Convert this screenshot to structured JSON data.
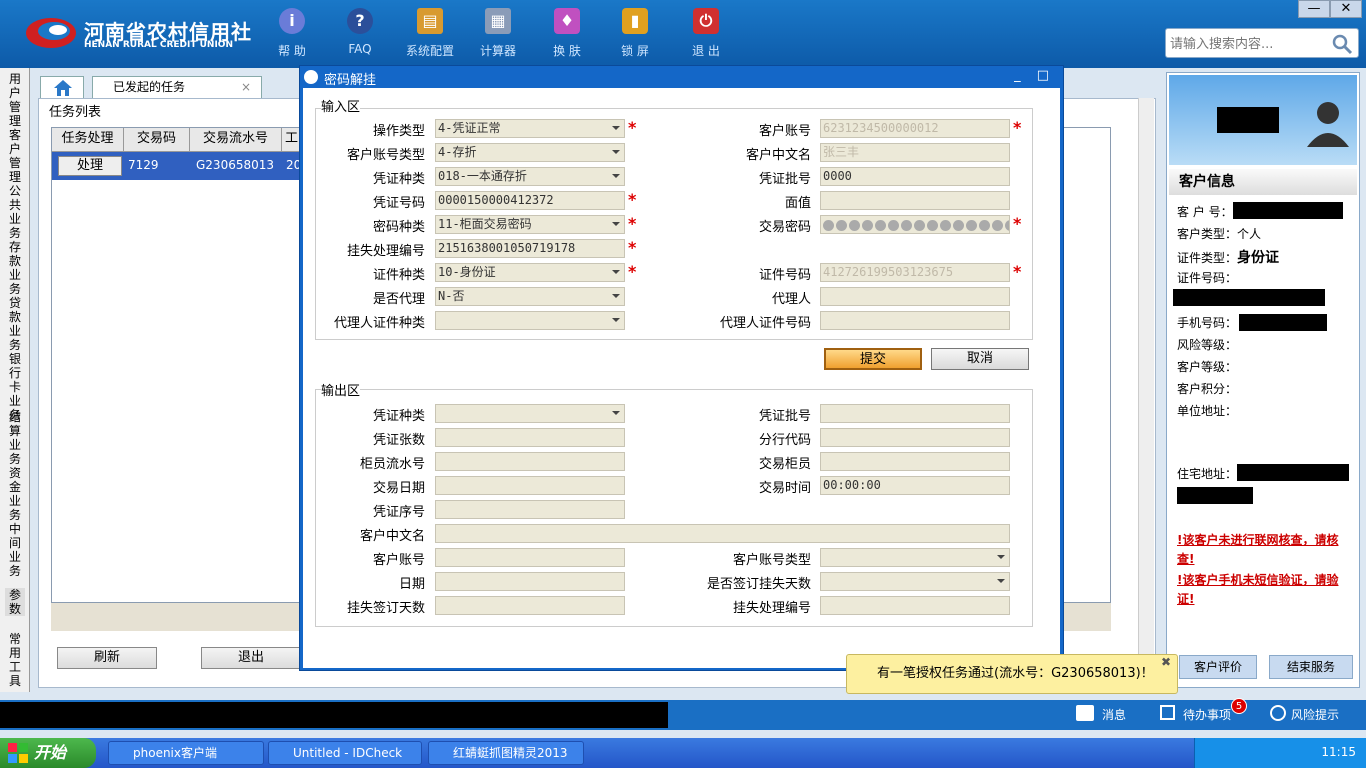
{
  "brand": {
    "name_cn": "河南省农村信用社",
    "name_en": "HENAN RURAL CREDIT UNION"
  },
  "toolbar": [
    {
      "label": "帮 助",
      "icon": "info-icon"
    },
    {
      "label": "FAQ",
      "icon": "question-icon"
    },
    {
      "label": "系统配置",
      "icon": "toolbox-icon"
    },
    {
      "label": "计算器",
      "icon": "calculator-icon"
    },
    {
      "label": "换 肤",
      "icon": "shirt-icon"
    },
    {
      "label": "锁 屏",
      "icon": "lock-icon"
    },
    {
      "label": "退 出",
      "icon": "power-icon"
    }
  ],
  "search": {
    "placeholder": "请输入搜索内容..."
  },
  "window_controls": {
    "minimize": "—",
    "close": "✕"
  },
  "left_nav": [
    "用户管理",
    "客户管理",
    "公共业务",
    "存款业务",
    "贷款业务",
    "银行卡业务",
    "结算业务",
    "资金业务",
    "中间业务",
    "参数",
    "常用工具"
  ],
  "tabs": {
    "task_tab": "已发起的任务",
    "close": "×"
  },
  "task_panel": {
    "title": "任务列表",
    "columns": [
      "任务处理",
      "交易码",
      "交易流水号",
      "工"
    ],
    "row": {
      "action": "处理",
      "code": "7129",
      "serial": "G230658013",
      "extra": "20"
    },
    "refresh": "刷新",
    "exit": "退出"
  },
  "dialog": {
    "title": "密码解挂",
    "controls": "_ □",
    "input_section": "输入区",
    "output_section": "输出区",
    "input_left": [
      {
        "label": "操作类型",
        "value": "4-凭证正常",
        "dropdown": true,
        "required": true
      },
      {
        "label": "客户账号类型",
        "value": "4-存折",
        "dropdown": true,
        "required": false
      },
      {
        "label": "凭证种类",
        "value": "018-一本通存折",
        "dropdown": true,
        "required": false
      },
      {
        "label": "凭证号码",
        "value": "0000150000412372",
        "dropdown": false,
        "required": true
      },
      {
        "label": "密码种类",
        "value": "11-柜面交易密码",
        "dropdown": true,
        "required": true
      },
      {
        "label": "挂失处理编号",
        "value": "2151638001050719178",
        "dropdown": false,
        "required": true
      },
      {
        "label": "证件种类",
        "value": "10-身份证",
        "dropdown": true,
        "required": true
      },
      {
        "label": "是否代理",
        "value": "N-否",
        "dropdown": true,
        "required": false
      },
      {
        "label": "代理人证件种类",
        "value": "",
        "dropdown": true,
        "required": false
      }
    ],
    "input_right": [
      {
        "label": "客户账号",
        "value": "6231234500000012",
        "required": true,
        "blur": true
      },
      {
        "label": "客户中文名",
        "value": "张三丰",
        "required": false,
        "blur": true
      },
      {
        "label": "凭证批号",
        "value": "0000",
        "required": false,
        "blur": false
      },
      {
        "label": "面值",
        "value": "",
        "required": false,
        "blur": false
      },
      {
        "label": "交易密码",
        "value": "",
        "required": true,
        "blur": false,
        "password": true
      },
      {
        "label": "",
        "value": "",
        "hidden": true
      },
      {
        "label": "证件号码",
        "value": "412726199503123675",
        "required": true,
        "blur": true
      },
      {
        "label": "代理人",
        "value": "",
        "required": false,
        "blur": false
      },
      {
        "label": "代理人证件号码",
        "value": "",
        "required": false,
        "blur": false
      }
    ],
    "submit": "提交",
    "cancel": "取消",
    "output_left": [
      {
        "label": "凭证种类",
        "value": "",
        "dropdown": true
      },
      {
        "label": "凭证张数",
        "value": "",
        "dropdown": false
      },
      {
        "label": "柜员流水号",
        "value": "",
        "dropdown": false
      },
      {
        "label": "交易日期",
        "value": "",
        "dropdown": false
      },
      {
        "label": "凭证序号",
        "value": "",
        "dropdown": false
      }
    ],
    "output_right": [
      {
        "label": "凭证批号",
        "value": ""
      },
      {
        "label": "分行代码",
        "value": ""
      },
      {
        "label": "交易柜员",
        "value": ""
      },
      {
        "label": "交易时间",
        "value": "00:00:00"
      }
    ],
    "out_name_label": "客户中文名",
    "output_bottom_left": [
      {
        "label": "客户账号",
        "value": ""
      },
      {
        "label": "日期",
        "value": ""
      },
      {
        "label": "挂失签订天数",
        "value": ""
      }
    ],
    "output_bottom_right": [
      {
        "label": "客户账号类型",
        "value": "",
        "dropdown": true
      },
      {
        "label": "是否签订挂失天数",
        "value": "",
        "dropdown": true
      },
      {
        "label": "挂失处理编号",
        "value": "",
        "dropdown": false
      }
    ]
  },
  "customer": {
    "header": "客户信息",
    "fields": [
      {
        "label": "客 户 号：",
        "value": ""
      },
      {
        "label": "客户类型：",
        "value": "个人"
      },
      {
        "label": "证件类型：",
        "value": "身份证"
      },
      {
        "label": "证件号码：",
        "value": ""
      },
      {
        "label": "手机号码：",
        "value": ""
      },
      {
        "label": "风险等级：",
        "value": ""
      },
      {
        "label": "客户等级：",
        "value": ""
      },
      {
        "label": "客户积分：",
        "value": ""
      },
      {
        "label": "单位地址：",
        "value": ""
      },
      {
        "label": "住宅地址：",
        "value": ""
      }
    ],
    "warning1": "!该客户未进行联网核查，请核查!",
    "warning2": "!该客户手机未短信验证，请验证!",
    "evaluate": "客户评价",
    "end_service": "结束服务"
  },
  "notification": {
    "text": "有一笔授权任务通过(流水号：G230658013)！",
    "close": "✖"
  },
  "status": {
    "message": "消息",
    "todo": "待办事项",
    "todo_count": "5",
    "risk": "风险提示"
  },
  "taskbar": {
    "start": "开始",
    "tasks": [
      "phoenix客户端",
      "Untitled - IDCheck",
      "红蜻蜓抓图精灵2013"
    ],
    "clock": "11:15"
  },
  "colors": {
    "brand_blue": "#1a78c8",
    "dialog_blue": "#1467c8",
    "required_red": "#d00000",
    "field_bg": "#ece9d8",
    "taskbar_blue": "#2456c8"
  }
}
